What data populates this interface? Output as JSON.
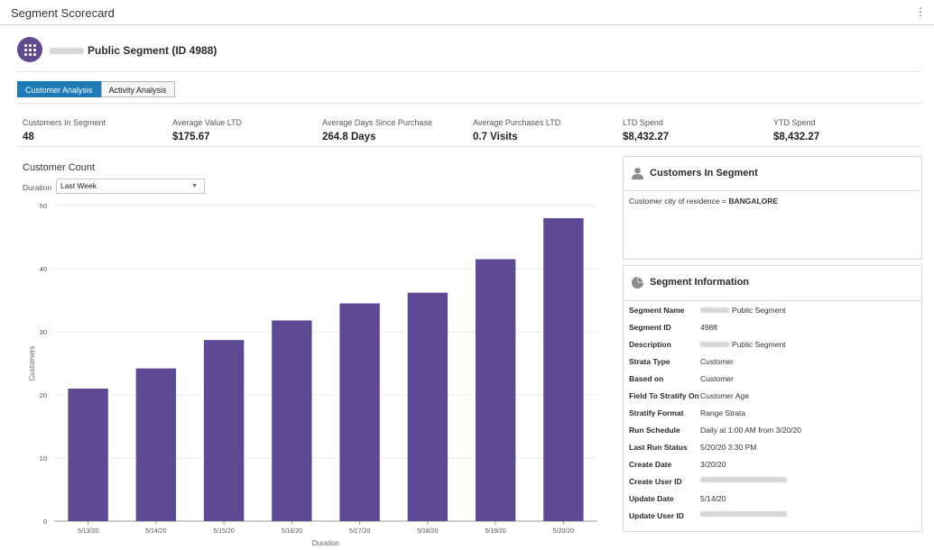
{
  "window": {
    "title": "Segment Scorecard",
    "menu_icon": "kebab-menu-icon"
  },
  "segment": {
    "name_visible": "Public Segment (ID 4988)",
    "icon": "segment-grid-icon",
    "icon_color": "#5f4b8b"
  },
  "tabs": [
    {
      "label": "Customer Analysis",
      "active": true
    },
    {
      "label": "Activity Analysis",
      "active": false
    }
  ],
  "metrics": [
    {
      "label": "Customers In Segment",
      "value": "48"
    },
    {
      "label": "Average Value LTD",
      "value": "$175.67"
    },
    {
      "label": "Average Days Since Purchase",
      "value": "264.8 Days"
    },
    {
      "label": "Average Purchases LTD",
      "value": "0.7 Visits"
    },
    {
      "label": "LTD Spend",
      "value": "$8,432.27"
    },
    {
      "label": "YTD Spend",
      "value": "$8,432.27"
    }
  ],
  "customer_count": {
    "title": "Customer Count",
    "duration_label": "Duration",
    "duration_value": "Last Week"
  },
  "chart_data": {
    "type": "bar",
    "categories": [
      "5/13/20",
      "5/14/20",
      "5/15/20",
      "5/16/20",
      "5/17/20",
      "5/18/20",
      "5/19/20",
      "5/20/20"
    ],
    "values": [
      21,
      24.2,
      28.7,
      31.8,
      34.5,
      36.2,
      41.5,
      48
    ],
    "xlabel": "Duration",
    "ylabel": "Customers",
    "ylim": [
      0,
      50
    ],
    "yticks": [
      0,
      10,
      20,
      30,
      40,
      50
    ],
    "bar_color": "#5e4a94",
    "grid": true
  },
  "customers_panel": {
    "title": "Customers In Segment",
    "icon": "person-icon",
    "rule_prefix": "Customer city of residence = ",
    "rule_value": "BANGALORE"
  },
  "segment_info": {
    "title": "Segment Information",
    "icon": "pie-chart-icon",
    "rows": [
      {
        "key": "Segment Name",
        "value": "Public Segment",
        "redacted_prefix": true
      },
      {
        "key": "Segment ID",
        "value": "4988"
      },
      {
        "key": "Description",
        "value": "Public Segment",
        "redacted_prefix": true
      },
      {
        "key": "Strata Type",
        "value": "Customer"
      },
      {
        "key": "Based on",
        "value": "Customer"
      },
      {
        "key": "Field To Stratify On",
        "value": "Customer Age"
      },
      {
        "key": "Stratify Format",
        "value": "Range Strata"
      },
      {
        "key": "Run Schedule",
        "value": "Daily at 1:00 AM from 3/20/20"
      },
      {
        "key": "Last Run Status",
        "value": "5/20/20 3:30 PM"
      },
      {
        "key": "Create Date",
        "value": "3/20/20"
      },
      {
        "key": "Create User ID",
        "value": "",
        "redacted": true
      },
      {
        "key": "Update Date",
        "value": "5/14/20"
      },
      {
        "key": "Update User ID",
        "value": "",
        "redacted": true
      }
    ]
  }
}
